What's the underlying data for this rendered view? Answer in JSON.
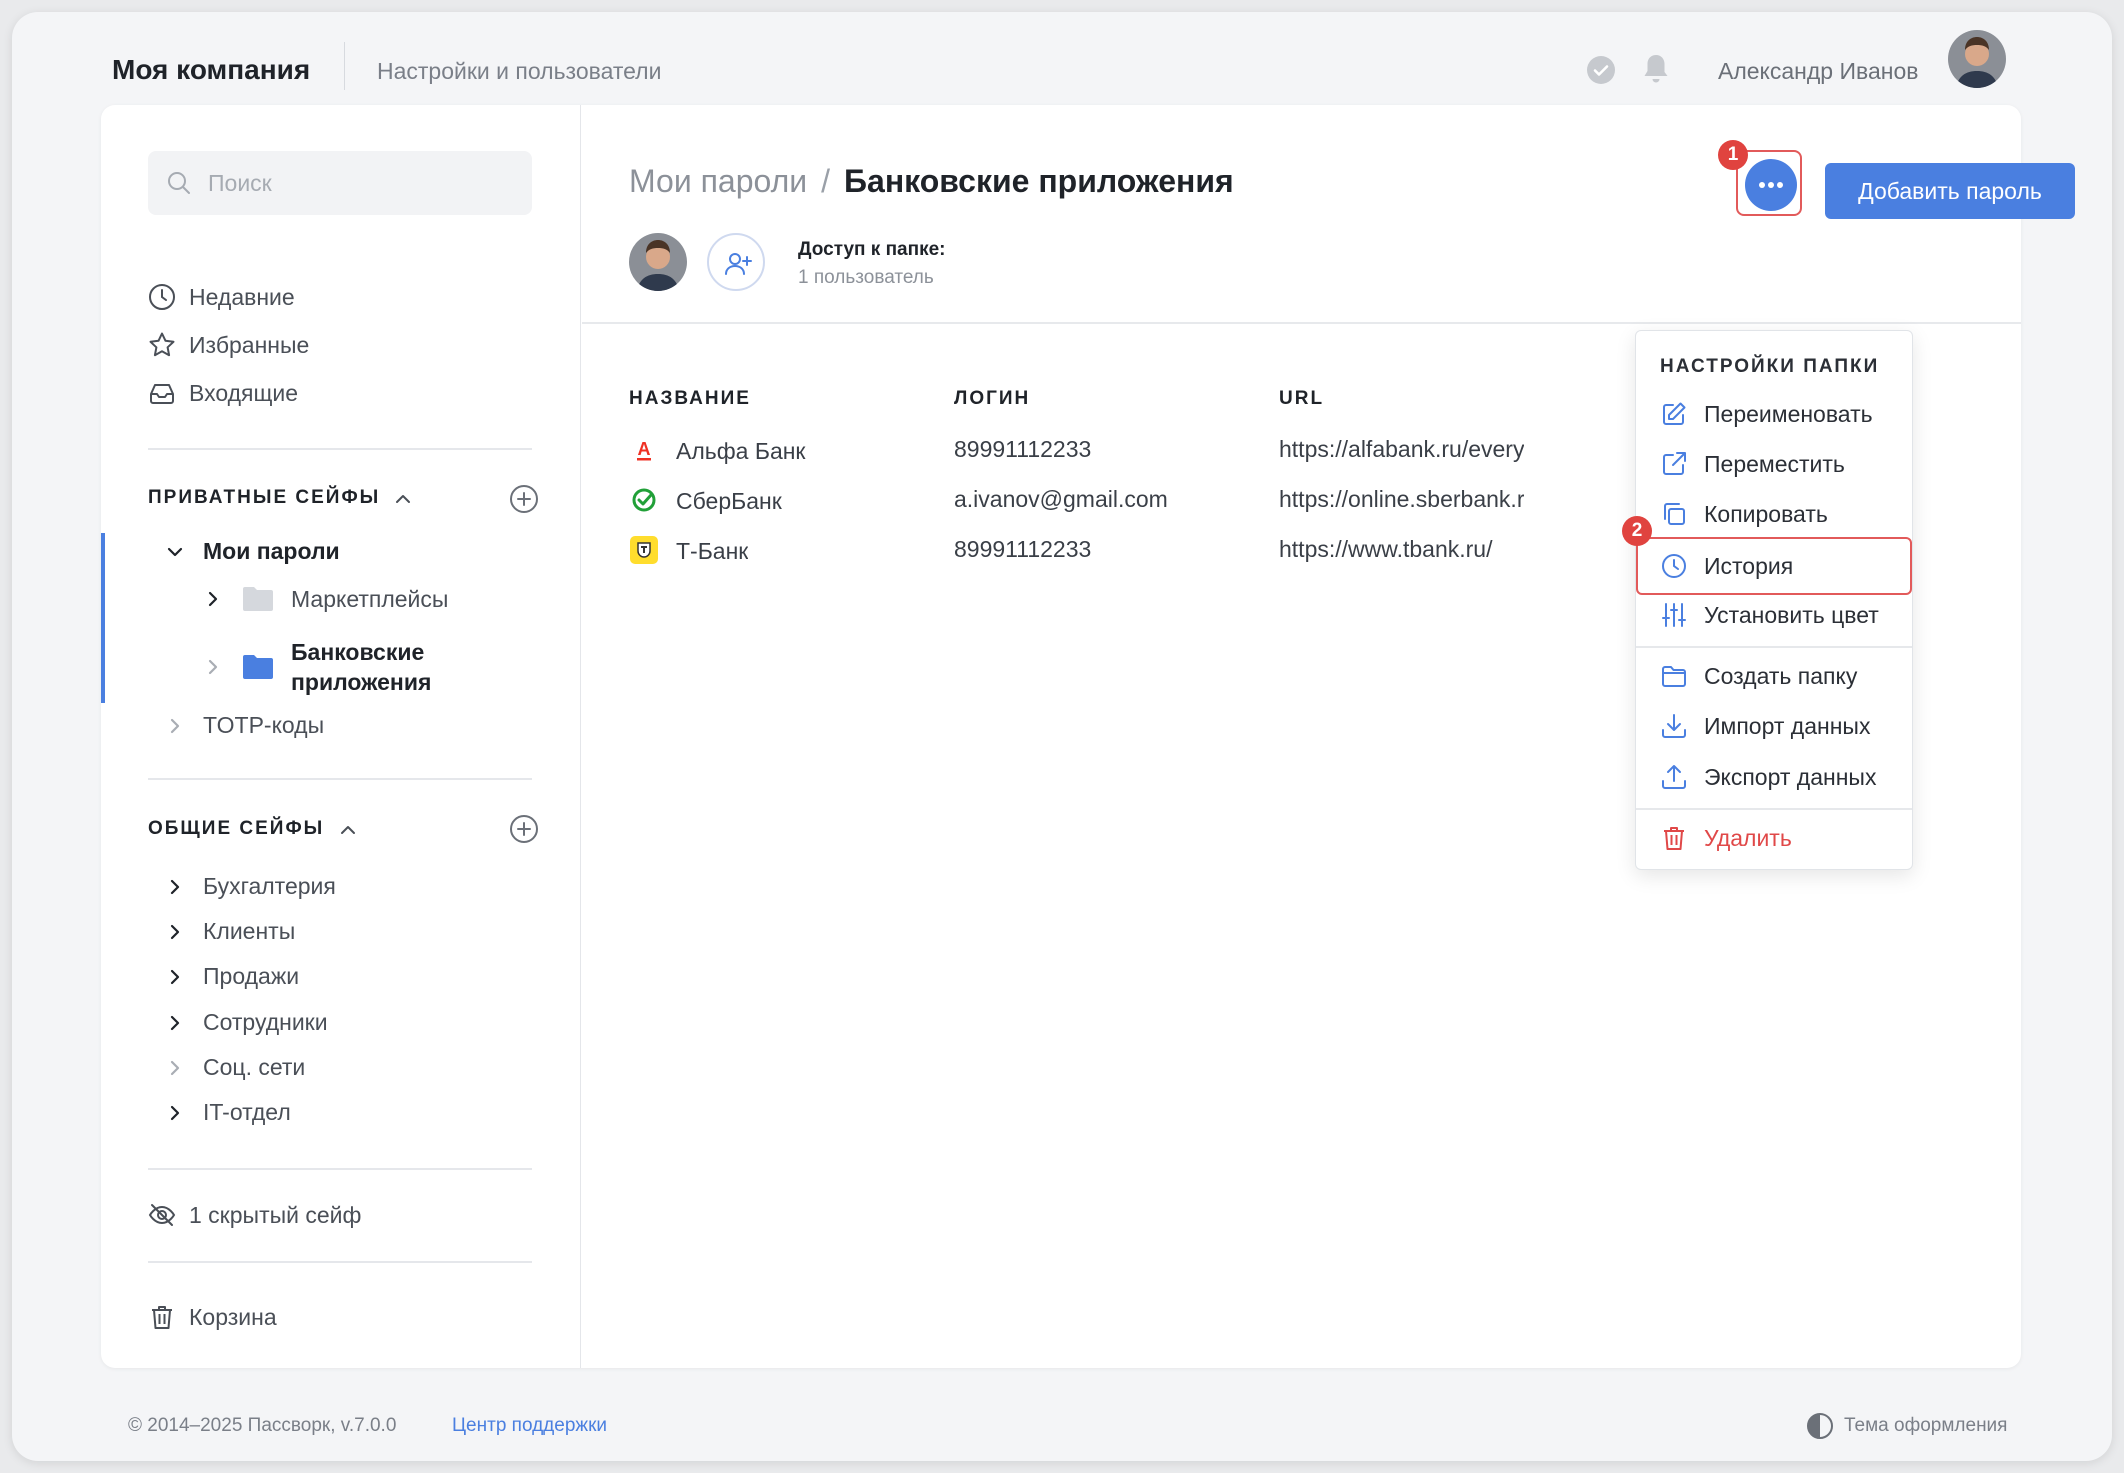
{
  "header": {
    "brand": "Моя компания",
    "subtitle": "Настройки и пользователи",
    "user_name": "Александр Иванов"
  },
  "sidebar": {
    "search_placeholder": "Поиск",
    "nav": [
      {
        "label": "Недавние",
        "icon": "clock-icon"
      },
      {
        "label": "Избранные",
        "icon": "star-icon"
      },
      {
        "label": "Входящие",
        "icon": "inbox-icon"
      }
    ],
    "private_title": "ПРИВАТНЫЕ СЕЙФЫ",
    "private": {
      "vault": "Мои пароли",
      "folder1": "Маркетплейсы",
      "folder2_line1": "Банковские",
      "folder2_line2": "приложения",
      "totp": "TOTP-коды"
    },
    "shared_title": "ОБЩИЕ СЕЙФЫ",
    "shared": [
      "Бухгалтерия",
      "Клиенты",
      "Продажи",
      "Сотрудники",
      "Соц. сети",
      "IT-отдел"
    ],
    "hidden": "1 скрытый сейф",
    "trash": "Корзина"
  },
  "main": {
    "breadcrumb_root": "Мои пароли",
    "breadcrumb_sep": "/",
    "breadcrumb_current": "Банковские приложения",
    "access_title": "Доступ к папке:",
    "access_sub": "1 пользователь",
    "add_button": "Добавить пароль",
    "badge1": "1",
    "badge2": "2",
    "columns": {
      "name": "НАЗВАНИЕ",
      "login": "ЛОГИН",
      "url": "URL"
    },
    "rows": [
      {
        "name": "Альфа Банк",
        "login": "89991112233",
        "url": "https://alfabank.ru/everyday/",
        "icon": "alfa-bank-icon"
      },
      {
        "name": "СберБанк",
        "login": "a.ivanov@gmail.com",
        "url": "https://online.sberbank.ru/",
        "icon": "sberbank-icon"
      },
      {
        "name": "Т-Банк",
        "login": "89991112233",
        "url": "https://www.tbank.ru/",
        "icon": "tbank-icon"
      }
    ]
  },
  "menu": {
    "title": "НАСТРОЙКИ ПАПКИ",
    "items": [
      {
        "label": "Переименовать",
        "icon": "edit-icon"
      },
      {
        "label": "Переместить",
        "icon": "move-icon"
      },
      {
        "label": "Копировать",
        "icon": "copy-icon"
      },
      {
        "label": "История",
        "icon": "history-icon"
      },
      {
        "label": "Установить цвет",
        "icon": "sliders-icon"
      },
      {
        "label": "Создать папку",
        "icon": "folder-icon"
      },
      {
        "label": "Импорт данных",
        "icon": "download-icon"
      },
      {
        "label": "Экспорт данных",
        "icon": "upload-icon"
      },
      {
        "label": "Удалить",
        "icon": "trash-icon"
      }
    ]
  },
  "footer": {
    "copyright": "© 2014–2025 Пассворк, v.7.0.0",
    "support_link": "Центр поддержки",
    "theme": "Тема оформления"
  },
  "colors": {
    "accent": "#4a7fe0",
    "danger": "#e04848",
    "badge": "#e0433f",
    "alfa": "#ef3124",
    "sber": "#21a038",
    "tbank": "#ffdd2d"
  }
}
